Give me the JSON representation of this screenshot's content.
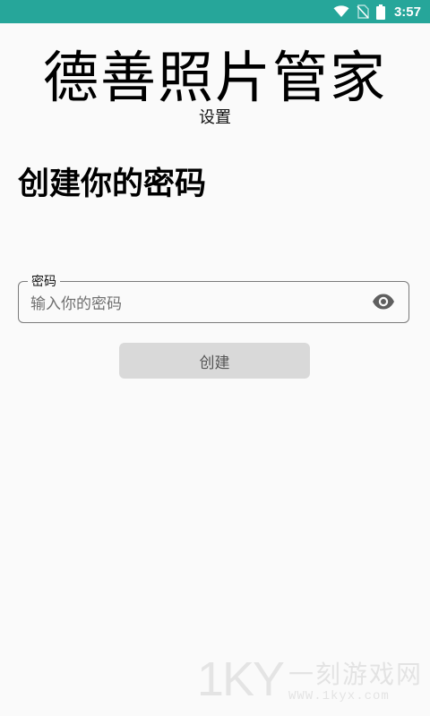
{
  "status_bar": {
    "time": "3:57",
    "icons": [
      "wifi-icon",
      "no-sim-icon",
      "battery-icon"
    ],
    "background": "#26a69a"
  },
  "app": {
    "title": "德善照片管家",
    "subtitle": "设置"
  },
  "page": {
    "heading": "创建你的密码"
  },
  "password_field": {
    "label": "密码",
    "placeholder": "输入你的密码",
    "value": "",
    "toggle_icon": "eye-icon"
  },
  "create_button": {
    "label": "创建",
    "background": "#d9d9d9"
  },
  "watermark": {
    "logo": "1KY",
    "name": "一刻游戏网",
    "url": "WWW.1kyx.com"
  }
}
